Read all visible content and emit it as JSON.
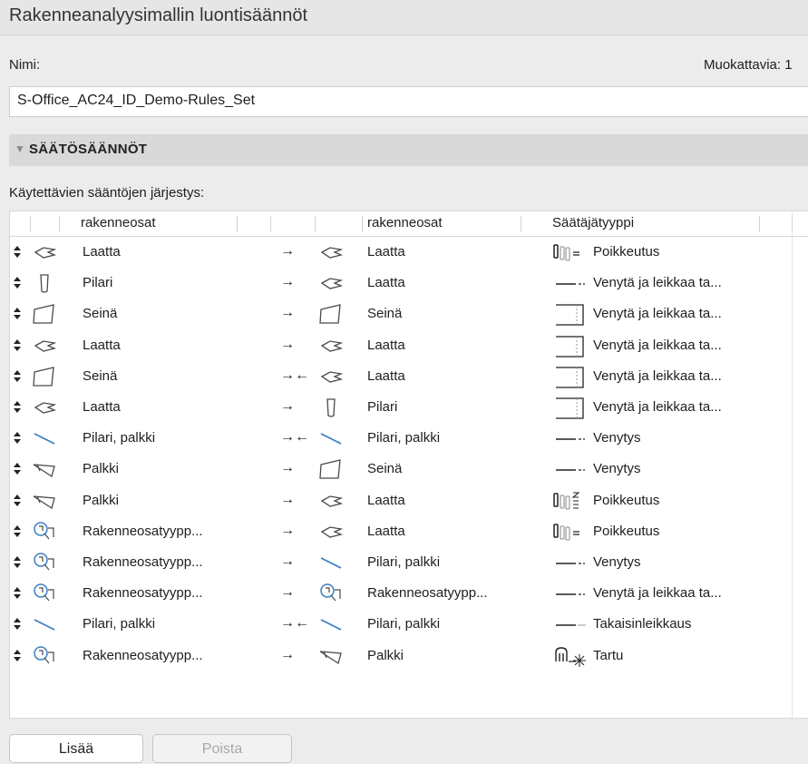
{
  "window": {
    "title": "Rakenneanalyysimallin luontisäännöt"
  },
  "name_label": "Nimi:",
  "editable_label": "Muokattavia: 1",
  "name_value": "S-Office_AC24_ID_Demo-Rules_Set",
  "section": {
    "label": "SÄÄTÖSÄÄNNÖT"
  },
  "order_label": "Käytettävien sääntöjen järjestys:",
  "table": {
    "headers": {
      "from": "rakenneosat",
      "to": "rakenneosat",
      "type": "Säätäjätyyppi"
    },
    "rows": [
      {
        "from_icon": "slab",
        "from": "Laatta",
        "dir": "→",
        "to_icon": "slab",
        "to": "Laatta",
        "type_icon": "offset-icon",
        "type": "Poikkeutus"
      },
      {
        "from_icon": "column",
        "from": "Pilari",
        "dir": "→",
        "to_icon": "slab",
        "to": "Laatta",
        "type_icon": "line-icon",
        "type": "Venytä ja leikkaa ta..."
      },
      {
        "from_icon": "wall",
        "from": "Seinä",
        "dir": "→",
        "to_icon": "wall",
        "to": "Seinä",
        "type_icon": "trim-box-icon",
        "type": "Venytä ja leikkaa ta..."
      },
      {
        "from_icon": "slab",
        "from": "Laatta",
        "dir": "→",
        "to_icon": "slab",
        "to": "Laatta",
        "type_icon": "trim-box-icon",
        "type": "Venytä ja leikkaa ta..."
      },
      {
        "from_icon": "wall",
        "from": "Seinä",
        "dir": "→←",
        "to_icon": "slab",
        "to": "Laatta",
        "type_icon": "trim-box-icon",
        "type": "Venytä ja leikkaa ta..."
      },
      {
        "from_icon": "slab",
        "from": "Laatta",
        "dir": "→",
        "to_icon": "column",
        "to": "Pilari",
        "type_icon": "trim-box-icon",
        "type": "Venytä ja leikkaa ta..."
      },
      {
        "from_icon": "beam-line",
        "from": "Pilari, palkki",
        "dir": "→←",
        "to_icon": "beam-line",
        "to": "Pilari, palkki",
        "type_icon": "line-icon",
        "type": "Venytys"
      },
      {
        "from_icon": "beam",
        "from": "Palkki",
        "dir": "→",
        "to_icon": "wall",
        "to": "Seinä",
        "type_icon": "line-icon",
        "type": "Venytys"
      },
      {
        "from_icon": "beam",
        "from": "Palkki",
        "dir": "→",
        "to_icon": "slab",
        "to": "Laatta",
        "type_icon": "offset-z-icon",
        "type": "Poikkeutus"
      },
      {
        "from_icon": "type-search",
        "from": "Rakenneosatyypp...",
        "dir": "→",
        "to_icon": "slab",
        "to": "Laatta",
        "type_icon": "offset-icon",
        "type": "Poikkeutus"
      },
      {
        "from_icon": "type-search",
        "from": "Rakenneosatyypp...",
        "dir": "→",
        "to_icon": "beam-line",
        "to": "Pilari, palkki",
        "type_icon": "line-icon",
        "type": "Venytys"
      },
      {
        "from_icon": "type-search",
        "from": "Rakenneosatyypp...",
        "dir": "→",
        "to_icon": "type-search",
        "to": "Rakenneosatyypp...",
        "type_icon": "line-icon",
        "type": "Venytä ja leikkaa ta..."
      },
      {
        "from_icon": "beam-line",
        "from": "Pilari, palkki",
        "dir": "→←",
        "to_icon": "beam-line",
        "to": "Pilari, palkki",
        "type_icon": "cutback-icon",
        "type": "Takaisinleikkaus"
      },
      {
        "from_icon": "type-search",
        "from": "Rakenneosatyypp...",
        "dir": "→",
        "to_icon": "beam",
        "to": "Palkki",
        "type_icon": "snap-icon",
        "type": "Tartu"
      }
    ]
  },
  "buttons": {
    "add": "Lisää",
    "remove": "Poista"
  },
  "colors": {
    "accent": "#3d7fc4",
    "icon": "#4a4a4a"
  }
}
